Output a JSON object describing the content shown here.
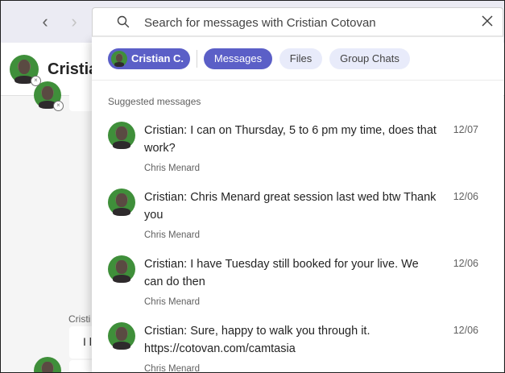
{
  "header": {
    "contact_name": "Cristian"
  },
  "search": {
    "placeholder": "Search for messages with Cristian Cotovan"
  },
  "filters": {
    "person_chip": "Cristian C.",
    "messages": "Messages",
    "files": "Files",
    "group_chats": "Group Chats"
  },
  "section_label": "Suggested messages",
  "results": [
    {
      "text": "Cristian: I can on Thursday, 5 to 6 pm my time, does that work?",
      "date": "12/07",
      "sender": "Chris Menard"
    },
    {
      "text": "Cristian: Chris Menard great session last wed btw Thank you",
      "date": "12/06",
      "sender": "Chris Menard"
    },
    {
      "text": "Cristian: I have Tuesday still booked for your live. We can do then",
      "date": "12/06",
      "sender": "Chris Menard"
    },
    {
      "text": "Cristian: Sure, happy to walk you through it. https://cotovan.com/camtasia",
      "date": "12/06",
      "sender": "Chris Menard"
    }
  ],
  "background_chat": {
    "sender": "Cristi",
    "bubble_text": "I l"
  },
  "colors": {
    "accent": "#5b5fc7",
    "pill_inactive": "#e8ebfa",
    "avatar_bg": "#3f8f3a"
  }
}
